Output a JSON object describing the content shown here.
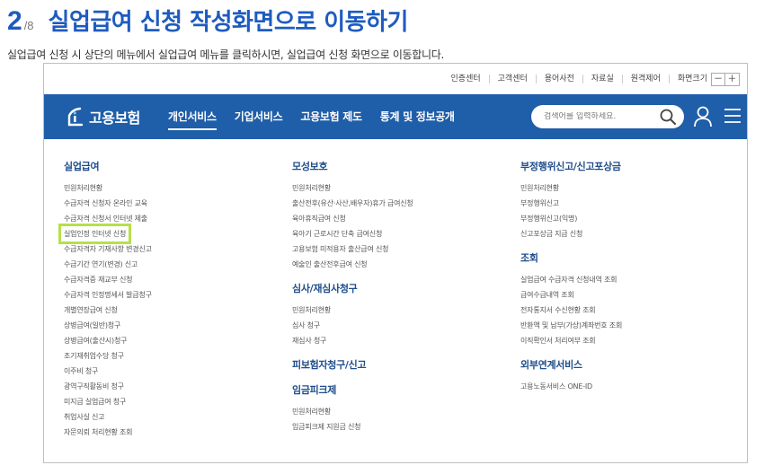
{
  "step": {
    "number": "2",
    "total": "/8",
    "title": "실업급여 신청 작성화면으로 이동하기",
    "description": "실업급여 신청 시 상단의 메뉴에서 실업급여 메뉴를 클릭하시면, 실업급여 신청 화면으로 이동합니다."
  },
  "util_bar": {
    "links": [
      "인증센터",
      "고객센터",
      "용어사전",
      "자료실",
      "원격제어"
    ],
    "font_size_label": "화면크기",
    "font_minus": "－",
    "font_plus": "＋"
  },
  "nav": {
    "logo_text": "고용보험",
    "menu": [
      "개인서비스",
      "기업서비스",
      "고용보험 제도",
      "통계 및 정보공개"
    ],
    "active_index": 0,
    "search_placeholder": "검색어를 입력하세요.",
    "color": "#1f5ea8"
  },
  "columns": [
    {
      "sections": [
        {
          "title": "실업급여",
          "items": [
            "민원처리현황",
            "수급자격 신청자 온라인 교육",
            "수급자격 신청서 인터넷 제출",
            "실업인정 인터넷 신청",
            "수급자격자 기재사항 변경신고",
            "수급기간 연기(변경) 신고",
            "수급자격증 재교부 신청",
            "수급자격 인정명세서 발급청구",
            "개별연장급여 신청",
            "상병급여(일반)청구",
            "상병급여(출산시)청구",
            "조기재취업수당 청구",
            "이주비 청구",
            "광역구직활동비 청구",
            "미지급 실업급여 청구",
            "취업사실 신고",
            "자문의뢰 처리현황 조회"
          ]
        }
      ]
    },
    {
      "sections": [
        {
          "title": "모성보호",
          "items": [
            "민원처리현황",
            "출산전후(유산·사산,배우자)휴가 급여신청",
            "육아휴직급여 신청",
            "육아기 근로시간 단축 급여신청",
            "고용보험 미적용자 출산급여 신청",
            "예술인 출산전후급여 신청"
          ]
        },
        {
          "title": "심사/재심사청구",
          "items": [
            "민원처리현황",
            "심사 청구",
            "재심사 청구"
          ]
        },
        {
          "title": "피보험자청구/신고",
          "items": []
        },
        {
          "title": "임금피크제",
          "items": [
            "민원처리현황",
            "임금피크제 지원금 신청"
          ]
        }
      ]
    },
    {
      "sections": [
        {
          "title": "부정행위신고/신고포상금",
          "items": [
            "민원처리현황",
            "부정행위신고",
            "부정행위신고(익명)",
            "신고포상금 지급 신청"
          ]
        },
        {
          "title": "조회",
          "items": [
            "실업급여 수급자격 신청내역 조회",
            "급여수급내역 조회",
            "전자통지서 수신현황 조회",
            "반환액 및 납부(가상)계좌번호 조회",
            "이직확인서 처리여부 조회"
          ]
        },
        {
          "title": "외부연계서비스",
          "items": [
            "고용노동서비스 ONE-ID"
          ]
        }
      ]
    }
  ],
  "highlight": {
    "item": "실업인정 인터넷 신청",
    "color": "#b7e04a"
  }
}
